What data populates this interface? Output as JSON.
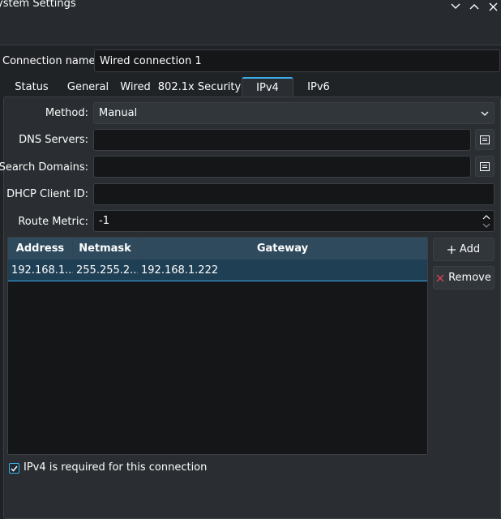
{
  "window": {
    "title": "ystem Settings"
  },
  "connection_name": {
    "label": "Connection name:",
    "value": "Wired connection 1"
  },
  "tabs": [
    {
      "label": "Status"
    },
    {
      "label": "General"
    },
    {
      "label": "Wired"
    },
    {
      "label": "802.1x Security"
    },
    {
      "label": "IPv4"
    },
    {
      "label": "IPv6"
    }
  ],
  "active_tab": "IPv4",
  "ipv4": {
    "method": {
      "label": "Method:",
      "value": "Manual"
    },
    "dns_servers": {
      "label": "DNS Servers:",
      "value": ""
    },
    "search_domains": {
      "label": "Search Domains:",
      "value": ""
    },
    "dhcp_client_id": {
      "label": "DHCP Client ID:",
      "value": ""
    },
    "route_metric": {
      "label": "Route Metric:",
      "value": "-1"
    }
  },
  "table": {
    "columns": [
      "Address",
      "Netmask",
      "Gateway"
    ],
    "rows": [
      {
        "address": "192.168.1....",
        "netmask": "255.255.2...",
        "gateway": "192.168.1.222"
      }
    ]
  },
  "buttons": {
    "add": "Add",
    "remove": "Remove"
  },
  "required_checkbox": {
    "label": "IPv4 is required for this connection",
    "checked": true
  },
  "colors": {
    "accent": "#3daee9",
    "remove_icon": "#da4453",
    "background": "#202326",
    "panel": "#2a2e32"
  }
}
